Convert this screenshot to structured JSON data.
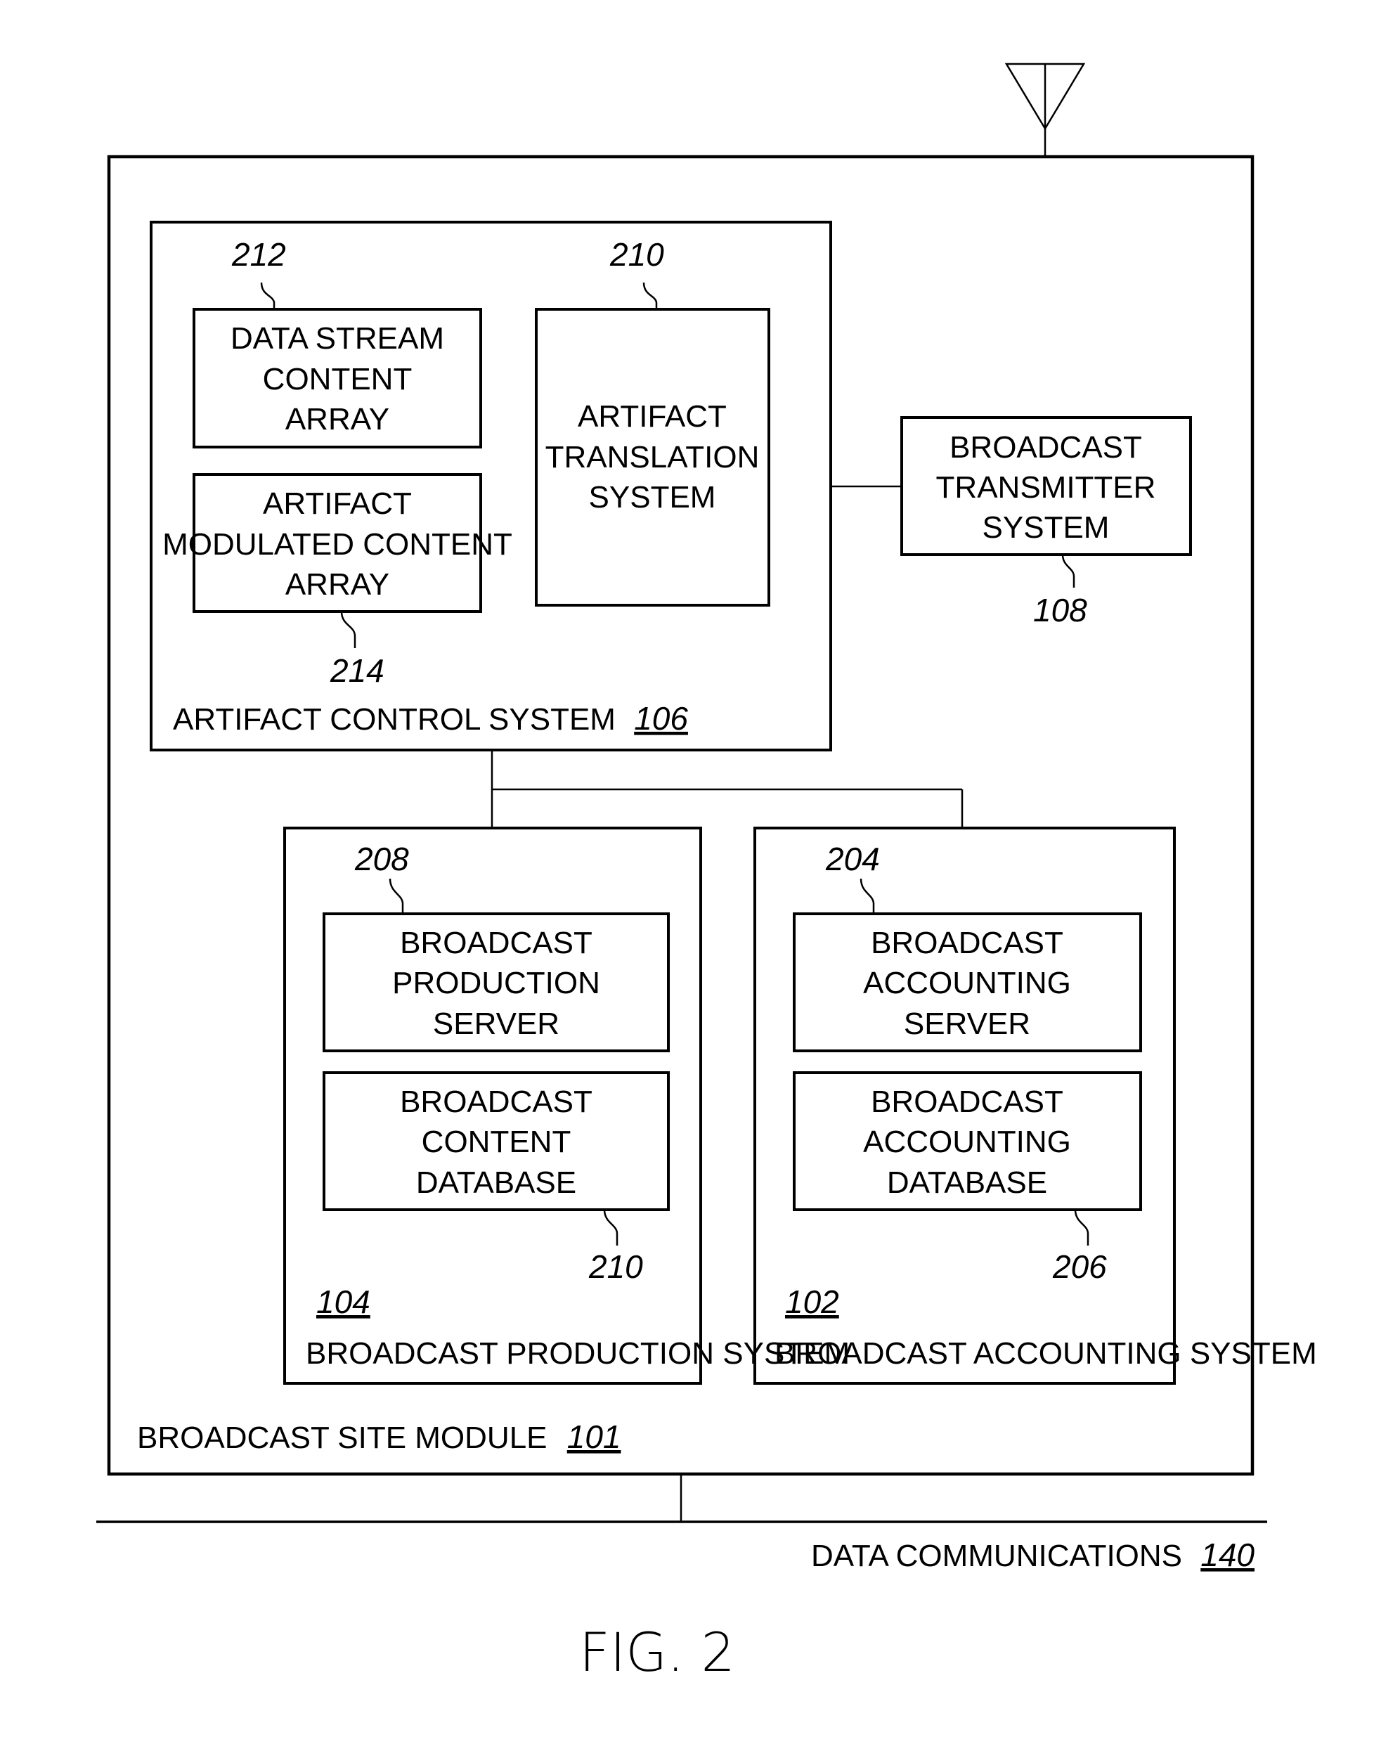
{
  "figure": {
    "caption": "FIG. 2",
    "broadcast_site_module": {
      "label": "BROADCAST SITE MODULE",
      "ref": "101"
    },
    "artifact_control_system": {
      "label": "ARTIFACT CONTROL SYSTEM",
      "ref": "106",
      "data_stream_content_array": {
        "lines": [
          "DATA STREAM",
          "CONTENT",
          "ARRAY"
        ],
        "ref": "212"
      },
      "artifact_modulated_content_array": {
        "lines": [
          "ARTIFACT",
          "MODULATED CONTENT",
          "ARRAY"
        ],
        "ref": "214"
      },
      "artifact_translation_system": {
        "lines": [
          "ARTIFACT",
          "TRANSLATION",
          "SYSTEM"
        ],
        "ref": "210"
      }
    },
    "broadcast_transmitter_system": {
      "lines": [
        "BROADCAST",
        "TRANSMITTER",
        "SYSTEM"
      ],
      "ref": "108"
    },
    "broadcast_production_system": {
      "label": "BROADCAST PRODUCTION SYSTEM",
      "ref": "104",
      "production_server": {
        "lines": [
          "BROADCAST",
          "PRODUCTION",
          "SERVER"
        ],
        "ref": "208"
      },
      "content_database": {
        "lines": [
          "BROADCAST",
          "CONTENT",
          "DATABASE"
        ],
        "ref": "210"
      }
    },
    "broadcast_accounting_system": {
      "label": "BROADCAST ACCOUNTING SYSTEM",
      "ref": "102",
      "accounting_server": {
        "lines": [
          "BROADCAST",
          "ACCOUNTING",
          "SERVER"
        ],
        "ref": "204"
      },
      "accounting_database": {
        "lines": [
          "BROADCAST",
          "ACCOUNTING",
          "DATABASE"
        ],
        "ref": "206"
      }
    },
    "data_communications": {
      "label": "DATA COMMUNICATIONS",
      "ref": "140"
    }
  }
}
